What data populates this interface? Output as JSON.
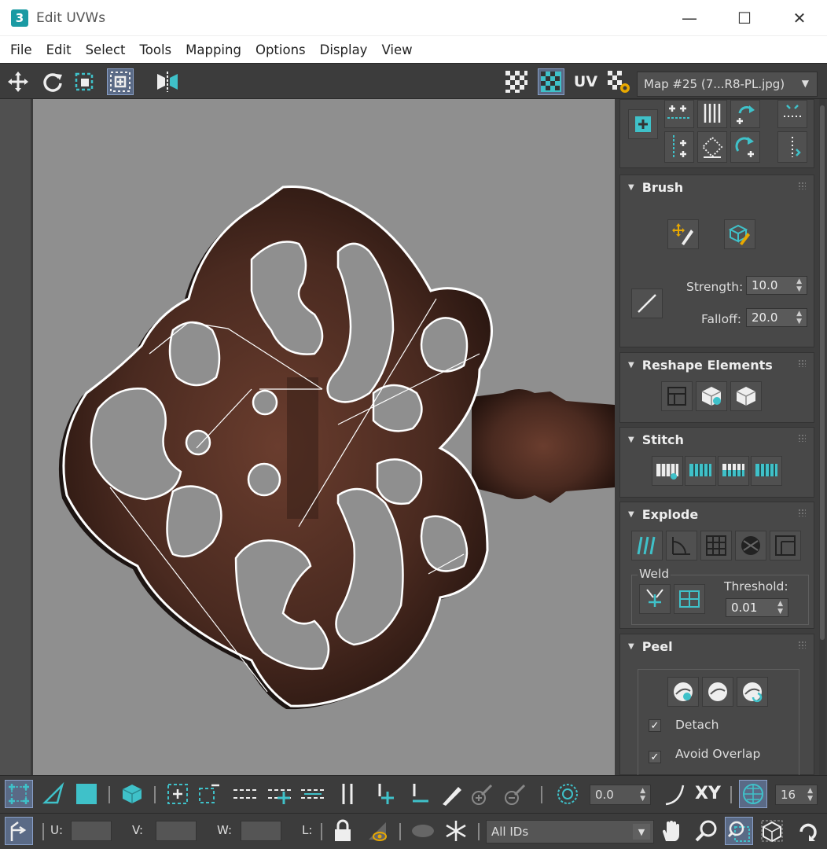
{
  "window": {
    "app_logo": "3",
    "title": "Edit UVWs",
    "minimize": "—",
    "maximize": "☐",
    "close": "✕"
  },
  "menu": [
    "File",
    "Edit",
    "Select",
    "Tools",
    "Mapping",
    "Options",
    "Display",
    "View"
  ],
  "toolbar": {
    "uv_label": "UV",
    "map_select": "Map #25 (7...R8-PL.jpg)"
  },
  "panel": {
    "brush": {
      "title": "Brush",
      "strength_label": "Strength:",
      "strength_value": "10.0",
      "falloff_label": "Falloff:",
      "falloff_value": "20.0"
    },
    "reshape": {
      "title": "Reshape Elements"
    },
    "stitch": {
      "title": "Stitch"
    },
    "explode": {
      "title": "Explode",
      "weld_label": "Weld",
      "threshold_label": "Threshold:",
      "threshold_value": "0.01"
    },
    "peel": {
      "title": "Peel",
      "detach_label": "Detach",
      "detach_checked": true,
      "avoid_overlap_label": "Avoid Overlap",
      "avoid_overlap_checked": true
    }
  },
  "bottom": {
    "angle_value": "0.0",
    "xy_label": "XY",
    "grid_value": "16",
    "u_label": "U:",
    "v_label": "V:",
    "w_label": "W:",
    "l_label": "L:",
    "ids_select": "All IDs"
  },
  "colors": {
    "accent": "#3fc1c9",
    "viewport_bg": "#8f8f8f",
    "panel_bg": "#484848"
  }
}
